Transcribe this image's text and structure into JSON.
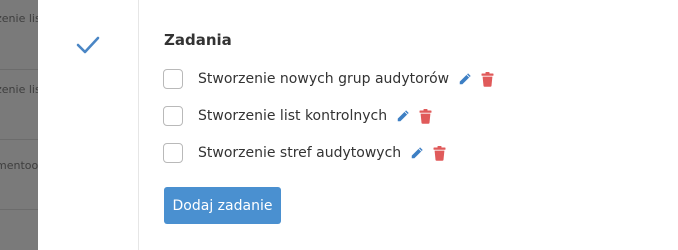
{
  "background": {
    "rows": [
      {
        "text": "zenie lis"
      },
      {
        "text": "zenie lis"
      },
      {
        "text": "mentoo"
      }
    ]
  },
  "section": {
    "title": "Zadania",
    "status_icon": "check-icon"
  },
  "tasks": [
    {
      "label": "Stworzenie nowych grup audytorów",
      "checked": false
    },
    {
      "label": "Stworzenie list kontrolnych",
      "checked": false
    },
    {
      "label": "Stworzenie stref audytowych",
      "checked": false
    }
  ],
  "icons": {
    "edit": "pencil-icon",
    "delete": "trash-icon"
  },
  "colors": {
    "accent": "#4a90d0",
    "delete": "#e05a5a",
    "edit": "#3d7fc4",
    "check": "#4a86c5"
  },
  "add_task_button": {
    "label": "Dodaj zadanie"
  }
}
